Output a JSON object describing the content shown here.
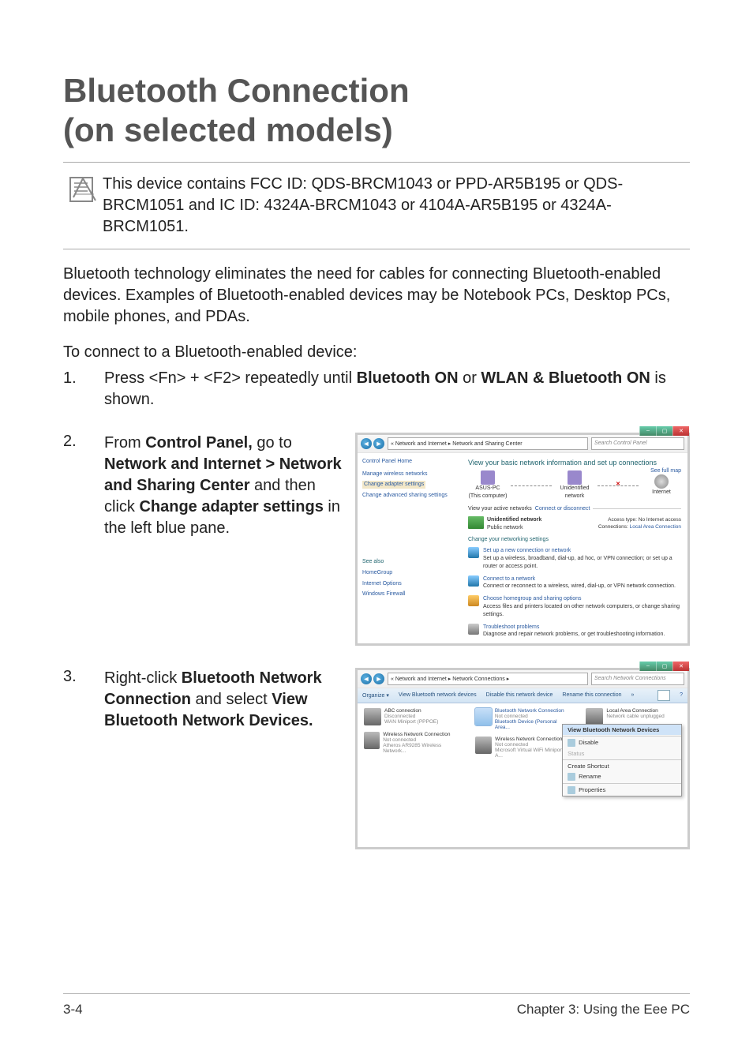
{
  "title_line1": "Bluetooth Connection",
  "title_line2": "(on selected models)",
  "note": "This device contains FCC ID: QDS-BRCM1043 or PPD-AR5B195 or QDS-BRCM1051 and IC ID: 4324A-BRCM1043 or 4104A-AR5B195 or 4324A-BRCM1051.",
  "intro": "Bluetooth technology eliminates the need for cables for connecting Bluetooth-enabled devices. Examples of Bluetooth-enabled devices may be Notebook PCs, Desktop PCs, mobile phones, and PDAs.",
  "pre_steps": "To connect to a Bluetooth-enabled device:",
  "step1": {
    "num": "1.",
    "pre": "Press <Fn> + <F2> repeatedly until ",
    "b1": "Bluetooth ON",
    "mid": " or ",
    "b2": "WLAN & Bluetooth ON",
    "post": " is shown."
  },
  "step2": {
    "num": "2.",
    "pre": "From ",
    "b1": "Control Panel,",
    "t1": " go to ",
    "b2": "Network and Internet > Network and Sharing Center",
    "t2": " and then click ",
    "b3": "Change adapter settings",
    "t3": " in the left blue pane."
  },
  "step3": {
    "num": "3.",
    "pre": "Right-click ",
    "b1": "Bluetooth Network Connection",
    "t1": " and select ",
    "b2": "View Bluetooth Network Devices."
  },
  "shot1": {
    "address": "« Network and Internet ▸ Network and Sharing Center",
    "search_placeholder": "Search Control Panel",
    "left": {
      "home": "Control Panel Home",
      "links": [
        "Manage wireless networks",
        "Change adapter settings",
        "Change advanced sharing settings"
      ],
      "see_also": "See also",
      "bottom_links": [
        "HomeGroup",
        "Internet Options",
        "Windows Firewall"
      ]
    },
    "right": {
      "heading": "View your basic network information and set up connections",
      "see_full": "See full map",
      "nodes": {
        "pc": "ASUS-PC",
        "pc_sub": "(This computer)",
        "mid": "Unidentified network",
        "net": "Internet"
      },
      "active_hdr": "View your active networks",
      "active_right": "Connect or disconnect",
      "active": {
        "title": "Unidentified network",
        "subtitle": "Public network",
        "access_lbl": "Access type:",
        "access_val": "No Internet access",
        "conn_lbl": "Connections:",
        "conn_val": "Local Area Connection"
      },
      "change_hdr": "Change your networking settings",
      "options": [
        {
          "h": "Set up a new connection or network",
          "s": "Set up a wireless, broadband, dial-up, ad hoc, or VPN connection; or set up a router or access point."
        },
        {
          "h": "Connect to a network",
          "s": "Connect or reconnect to a wireless, wired, dial-up, or VPN network connection."
        },
        {
          "h": "Choose homegroup and sharing options",
          "s": "Access files and printers located on other network computers, or change sharing settings."
        },
        {
          "h": "Troubleshoot problems",
          "s": "Diagnose and repair network problems, or get troubleshooting information."
        }
      ]
    }
  },
  "shot2": {
    "address": "« Network and Internet ▸ Network Connections ▸",
    "search_placeholder": "Search Network Connections",
    "ribbon": {
      "organize": "Organize ▾",
      "a": "View Bluetooth network devices",
      "b": "Disable this network device",
      "c": "Rename this connection",
      "more": "»"
    },
    "items": [
      {
        "t": "ABC connection",
        "s1": "Disconnected",
        "s2": "WAN Miniport (PPPOE)"
      },
      {
        "t": "Wireless Network Connection",
        "s1": "Not connected",
        "s2": "Atheros AR9285 Wireless Network..."
      },
      {
        "t": "Bluetooth Network Connection",
        "s1": "Not connected",
        "s2": "Bluetooth Device (Personal Area..."
      },
      {
        "t": "Wireless Network Connection 2",
        "s1": "Not connected",
        "s2": "Microsoft Virtual WiFi Miniport A..."
      },
      {
        "t": "Local Area Connection",
        "s1": "Network cable unplugged",
        "s2": ""
      }
    ],
    "menu": [
      "View Bluetooth Network Devices",
      "Disable",
      "Status",
      "Create Shortcut",
      "Rename",
      "Properties"
    ]
  },
  "footer": {
    "left": "3-4",
    "right": "Chapter 3: Using the Eee PC"
  }
}
